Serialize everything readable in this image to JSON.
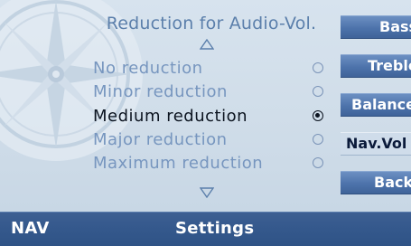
{
  "menu": {
    "title": "Reduction for Audio-Vol.",
    "options": [
      {
        "label": "No reduction",
        "selected": false
      },
      {
        "label": "Minor reduction",
        "selected": false
      },
      {
        "label": "Medium reduction",
        "selected": true
      },
      {
        "label": "Major reduction",
        "selected": false
      },
      {
        "label": "Maximum reduction",
        "selected": false
      }
    ]
  },
  "side_buttons": [
    {
      "label": "Bass",
      "active": false
    },
    {
      "label": "Treble",
      "active": false
    },
    {
      "label": "Balance",
      "active": false
    },
    {
      "label": "Nav.Vol",
      "active": true
    },
    {
      "label": "Back",
      "active": false
    }
  ],
  "footer": {
    "left": "NAV",
    "title": "Settings"
  },
  "colors": {
    "title_text": "#5b7fab",
    "option_text": "#7796bf",
    "selected_text": "#0c1420",
    "button_blue": "#4d73ab",
    "active_button": "#cfdcea",
    "footer_blue": "#34588c"
  },
  "icons": [
    "compass-watermark-icon",
    "scroll-up-icon",
    "scroll-down-icon"
  ]
}
